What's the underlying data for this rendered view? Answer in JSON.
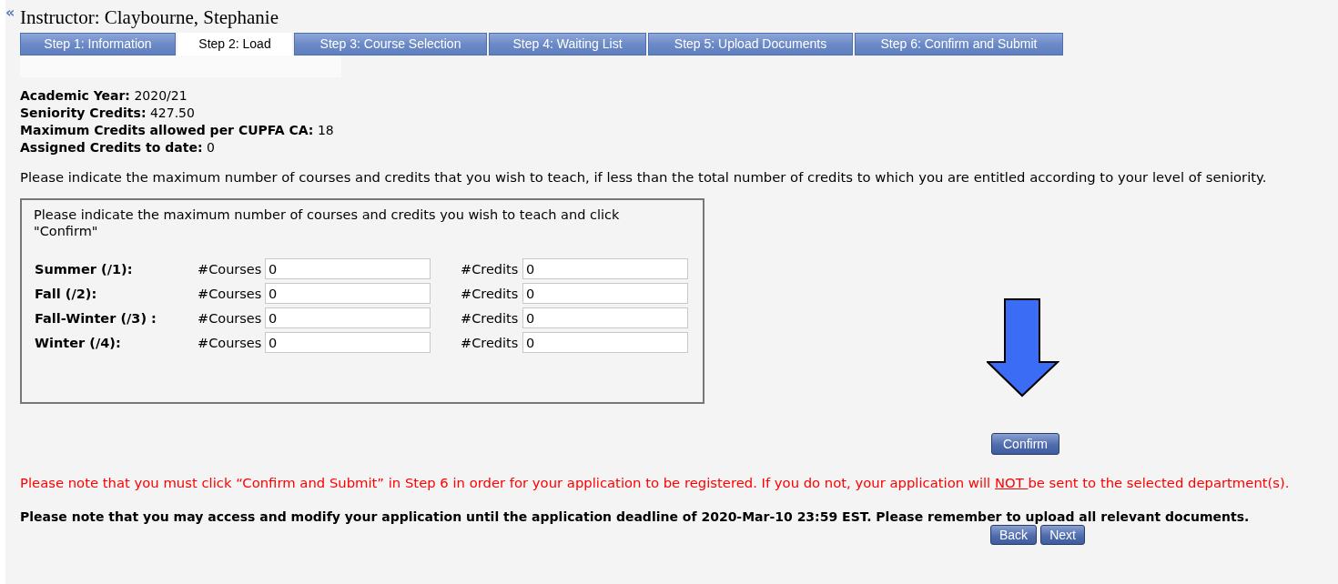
{
  "header": {
    "back_icon": "«",
    "title": "Instructor: Claybourne, Stephanie"
  },
  "tabs": [
    {
      "label": "Step 1: Information",
      "selected": false
    },
    {
      "label": "Step 2: Load",
      "selected": true
    },
    {
      "label": "Step 3: Course Selection",
      "selected": false
    },
    {
      "label": "Step 4: Waiting List",
      "selected": false
    },
    {
      "label": "Step 5: Upload Documents",
      "selected": false
    },
    {
      "label": "Step 6: Confirm and Submit",
      "selected": false
    }
  ],
  "info": [
    {
      "label": "Academic Year:",
      "value": "2020/21"
    },
    {
      "label": "Seniority Credits:",
      "value": "427.50"
    },
    {
      "label": "Maximum Credits allowed per CUPFA CA:",
      "value": "18"
    },
    {
      "label": "Assigned Credits to date:",
      "value": "0"
    }
  ],
  "instruction": "Please indicate the maximum number of courses and credits that you wish to teach, if less than the total number of credits to which you are entitled according to your level of seniority.",
  "load_form": {
    "intro": "Please indicate the maximum number of courses and credits you wish to teach and click \"Confirm\"",
    "terms": [
      {
        "label": "Summer (/1):",
        "courses_label": "#Courses",
        "courses_value": "0",
        "credits_label": "#Credits",
        "credits_value": "0"
      },
      {
        "label": "Fall (/2):",
        "courses_label": "#Courses",
        "courses_value": "0",
        "credits_label": "#Credits",
        "credits_value": "0"
      },
      {
        "label": "Fall-Winter (/3) :",
        "courses_label": "#Courses",
        "courses_value": "0",
        "credits_label": "#Credits",
        "credits_value": "0"
      },
      {
        "label": "Winter (/4):",
        "courses_label": "#Courses",
        "courses_value": "0",
        "credits_label": "#Credits",
        "credits_value": "0"
      }
    ]
  },
  "confirm_button": "Confirm",
  "warning": {
    "before": "Please note that you must click  “Confirm and Submit” in Step 6 in order for your application to be registered. If you do not, your application will ",
    "underlined": "NOT ",
    "after": "be sent to the selected department(s)."
  },
  "deadline_note": "Please note that you may access and modify your application until the application deadline of 2020-Mar-10 23:59 EST. Please remember to upload all relevant documents.",
  "nav_buttons": [
    "Back",
    "Next"
  ]
}
